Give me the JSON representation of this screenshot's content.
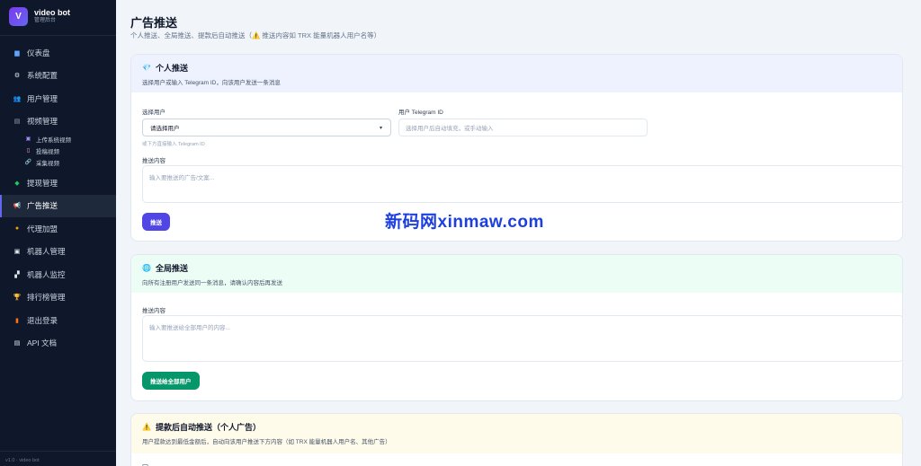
{
  "brand": {
    "logo_letter": "V",
    "name": "video bot",
    "subtitle": "管理后台"
  },
  "nav": [
    {
      "icon": "chart-icon",
      "glyph": "▆",
      "label": "仪表盘"
    },
    {
      "icon": "gear-icon",
      "glyph": "⚙",
      "label": "系统配置"
    },
    {
      "icon": "users-icon",
      "glyph": "👥",
      "label": "用户管理"
    },
    {
      "icon": "film-icon",
      "glyph": "▤",
      "label": "视频管理"
    }
  ],
  "video_sub": [
    {
      "icon": "upload-icon",
      "glyph": "▣",
      "label": "上传系统视频"
    },
    {
      "icon": "document-icon",
      "glyph": "▯",
      "label": "投稿视频"
    },
    {
      "icon": "link-icon",
      "glyph": "🔗",
      "label": "采集视频"
    }
  ],
  "nav2": [
    {
      "icon": "money-icon",
      "glyph": "◆",
      "label": "提现管理",
      "color": "#22c55e"
    },
    {
      "icon": "megaphone-icon",
      "glyph": "📢",
      "label": "广告推送",
      "active": true
    },
    {
      "icon": "handshake-icon",
      "glyph": "●",
      "label": "代理加盟",
      "color": "#f59e0b"
    },
    {
      "icon": "robot-icon",
      "glyph": "▣",
      "label": "机器人管理"
    },
    {
      "icon": "monitor-icon",
      "glyph": "▞",
      "label": "机器人监控"
    },
    {
      "icon": "trophy-icon",
      "glyph": "🏆",
      "label": "排行榜管理"
    },
    {
      "icon": "logout-icon",
      "glyph": "▮",
      "label": "退出登录",
      "color": "#f97316"
    },
    {
      "icon": "api-doc-icon",
      "glyph": "▤",
      "label": "API 文档"
    }
  ],
  "version": "v1.0 · video bot",
  "page": {
    "title": "广告推送",
    "subtitle": "个人推送、全局推送、提款后自动推送（⚠️ 推送内容如 TRX 能量机器人用户名等）"
  },
  "personal": {
    "icon": "💎",
    "title": "个人推送",
    "desc": "选择用户或输入 Telegram ID，向该用户发送一条消息",
    "select_label": "选择用户",
    "select_value": "请选择用户",
    "select_hint": "或下方直接输入 Telegram ID",
    "tgid_label": "用户 Telegram ID",
    "tgid_placeholder": "选择用户后自动填充，或手动输入",
    "content_label": "推送内容",
    "content_placeholder": "输入要推送的广告/文案...",
    "button": "推送"
  },
  "global": {
    "icon": "🌐",
    "title": "全局推送",
    "desc": "向所有注册用户发送同一条消息，请确认内容后再发送",
    "content_label": "推送内容",
    "content_placeholder": "输入要推送给全部用户的内容...",
    "button": "推送给全部用户"
  },
  "auto": {
    "icon": "⚠️",
    "title": "提款后自动推送（个人广告）",
    "desc": "用户提款达到最低金额后，自动向该用户推送下方内容（如 TRX 能量机器人用户名、其他广告）"
  },
  "watermark": "新码网xinmaw.com",
  "colors": {
    "sidebar_bg": "#0f172a",
    "accent": "#4f46e5",
    "green": "#059669"
  }
}
